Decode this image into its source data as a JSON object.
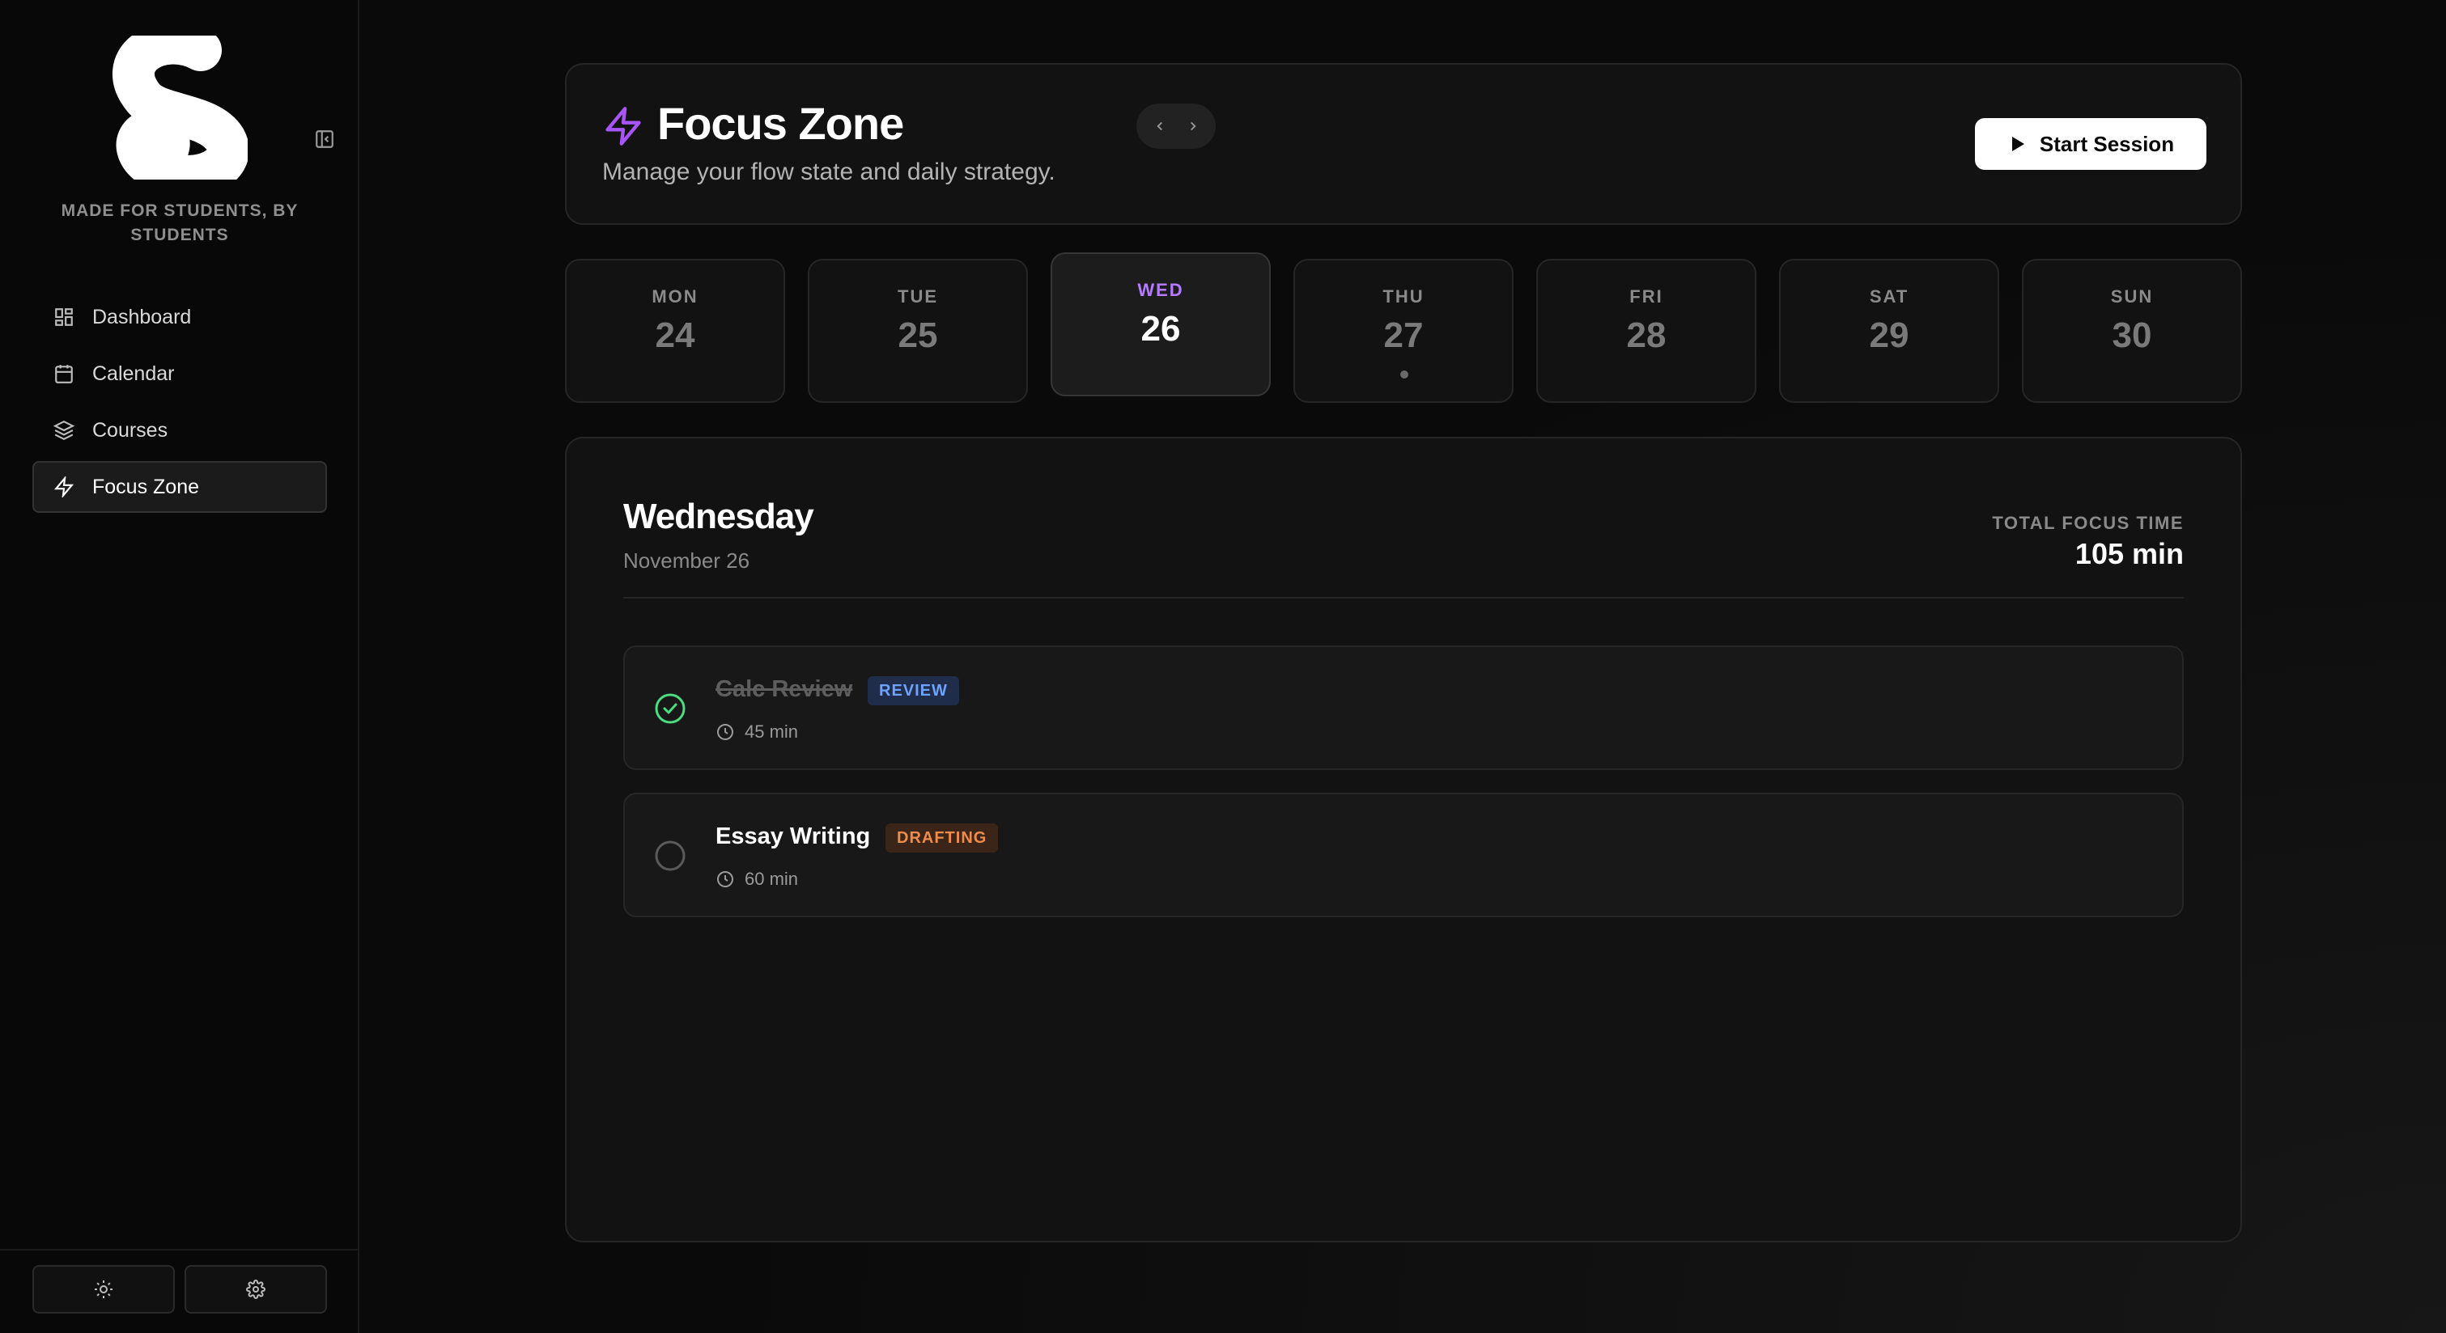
{
  "app": {
    "tagline": "MADE FOR STUDENTS, BY STUDENTS"
  },
  "sidebar": {
    "items": [
      {
        "label": "Dashboard",
        "icon": "dashboard-icon"
      },
      {
        "label": "Calendar",
        "icon": "calendar-icon"
      },
      {
        "label": "Courses",
        "icon": "layers-icon"
      },
      {
        "label": "Focus Zone",
        "icon": "bolt-icon",
        "active": true
      }
    ],
    "footer": {
      "theme_icon": "sun-icon",
      "settings_icon": "gear-icon"
    }
  },
  "header": {
    "title": "Focus Zone",
    "subtitle": "Manage your flow state and daily strategy.",
    "start_label": "Start Session",
    "accent_color": "#a855f7"
  },
  "week": {
    "days": [
      {
        "name": "MON",
        "num": "24"
      },
      {
        "name": "TUE",
        "num": "25"
      },
      {
        "name": "WED",
        "num": "26",
        "active": true
      },
      {
        "name": "THU",
        "num": "27",
        "has_event": true
      },
      {
        "name": "FRI",
        "num": "28"
      },
      {
        "name": "SAT",
        "num": "29"
      },
      {
        "name": "SUN",
        "num": "30"
      }
    ]
  },
  "detail": {
    "day_name": "Wednesday",
    "date": "November 26",
    "total_label": "TOTAL FOCUS TIME",
    "total_value": "105 min"
  },
  "tasks": [
    {
      "name": "Calc Review",
      "badge": "REVIEW",
      "duration": "45 min",
      "done": true,
      "badge_color": "#6ea2ff"
    },
    {
      "name": "Essay Writing",
      "badge": "DRAFTING",
      "duration": "60 min",
      "done": false,
      "badge_color": "#f08c4a"
    }
  ]
}
